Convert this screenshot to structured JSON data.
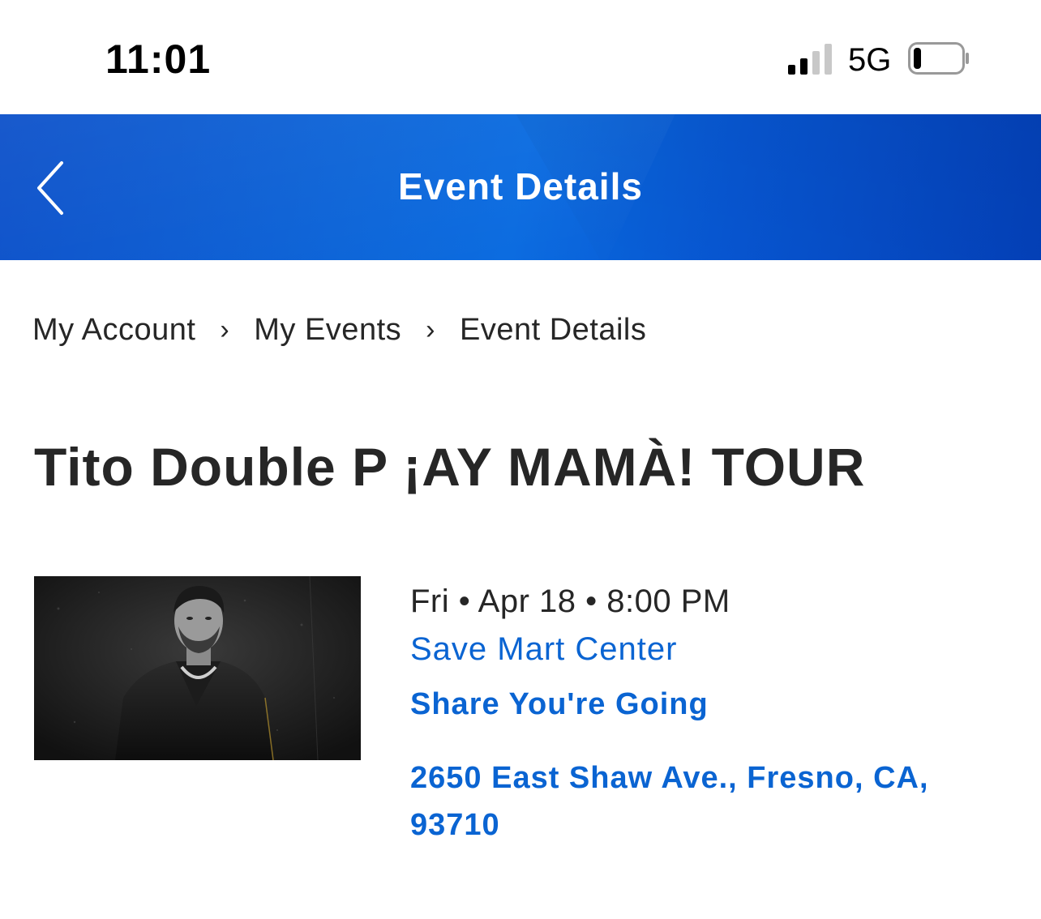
{
  "status_bar": {
    "time": "11:01",
    "network": "5G",
    "signal_icon": "cellular-signal-icon",
    "battery_icon": "battery-low-icon",
    "battery_level_fraction": 0.15
  },
  "header": {
    "title": "Event Details",
    "back_icon": "chevron-left-icon",
    "gradient_colors": [
      "#0a4fc9",
      "#0a6be0",
      "#0442bd"
    ]
  },
  "breadcrumb": {
    "items": [
      "My Account",
      "My Events",
      "Event Details"
    ],
    "separator": "›"
  },
  "event": {
    "title": "Tito Double P ¡AY MAMÀ! TOUR",
    "datetime": "Fri • Apr 18 • 8:00 PM",
    "venue": "Save Mart Center",
    "share_label": "Share You're Going",
    "address": "2650 East Shaw Ave., Fresno, CA, 93710"
  },
  "colors": {
    "link": "#0a64d2",
    "text": "#262626"
  }
}
